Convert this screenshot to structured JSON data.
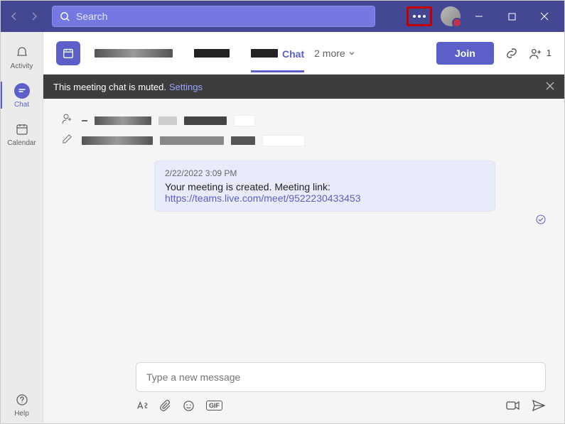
{
  "search": {
    "placeholder": "Search"
  },
  "rail": {
    "activity": "Activity",
    "chat": "Chat",
    "calendar": "Calendar",
    "help": "Help"
  },
  "header": {
    "tab_chat": "Chat",
    "more_tabs": "2 more",
    "join": "Join",
    "participants": "1"
  },
  "banner": {
    "text": "This meeting chat is muted.",
    "link": "Settings"
  },
  "message": {
    "timestamp": "2/22/2022 3:09 PM",
    "body": "Your meeting is created. Meeting link:",
    "link": "https://teams.live.com/meet/9522230433453"
  },
  "composer": {
    "placeholder": "Type a new message",
    "gif": "GIF"
  }
}
